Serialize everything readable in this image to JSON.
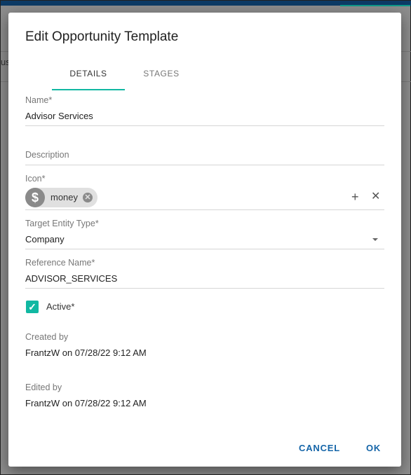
{
  "background": {
    "partial_text": "us"
  },
  "dialog": {
    "title": "Edit Opportunity Template",
    "tabs": [
      {
        "label": "DETAILS",
        "active": true
      },
      {
        "label": "STAGES",
        "active": false
      }
    ],
    "fields": {
      "name": {
        "label": "Name*",
        "value": "Advisor Services"
      },
      "description": {
        "label": "Description",
        "value": ""
      },
      "icon": {
        "label": "Icon*",
        "chip": "money",
        "chip_icon": "dollar-icon",
        "chip_avatar": "$"
      },
      "target_entity_type": {
        "label": "Target Entity Type*",
        "value": "Company"
      },
      "reference_name": {
        "label": "Reference Name*",
        "value": "ADVISOR_SERVICES"
      },
      "active": {
        "label": "Active*",
        "checked": true
      }
    },
    "created_by": {
      "label": "Created by",
      "value": "FrantzW on 07/28/22 9:12 AM"
    },
    "edited_by": {
      "label": "Edited by",
      "value": "FrantzW on 07/28/22 9:12 AM"
    },
    "actions": {
      "cancel": "CANCEL",
      "ok": "OK"
    }
  },
  "colors": {
    "accent": "#11b8a2",
    "button": "#1565a8",
    "topbar": "#0d3b66"
  }
}
